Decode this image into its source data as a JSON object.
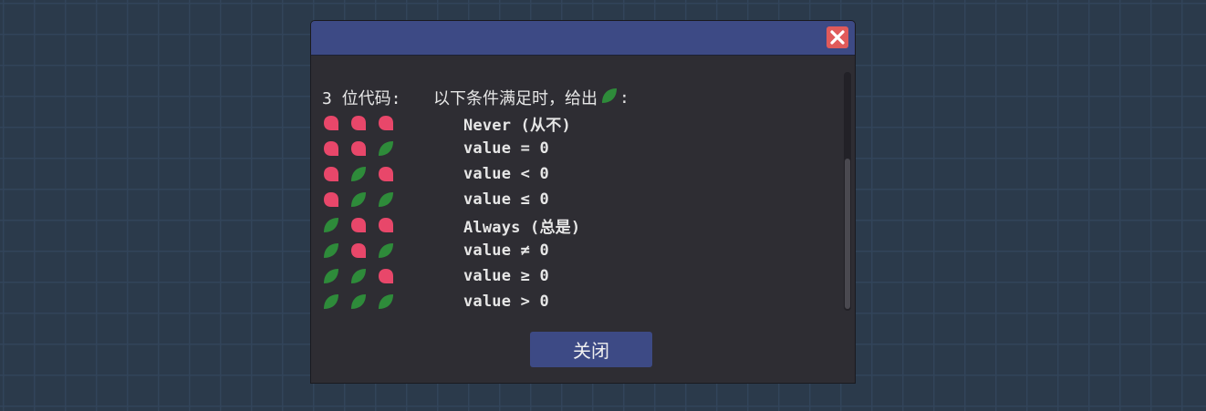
{
  "dialog": {
    "close_button_label": "关闭",
    "header": {
      "code_label": "3 位代码:",
      "condition_label": "以下条件满足时，给出",
      "condition_suffix": ":"
    },
    "rows": [
      {
        "bits": [
          "red",
          "red",
          "red"
        ],
        "condition": "Never (从不)"
      },
      {
        "bits": [
          "red",
          "red",
          "green"
        ],
        "condition": "value = 0"
      },
      {
        "bits": [
          "red",
          "green",
          "red"
        ],
        "condition": "value < 0"
      },
      {
        "bits": [
          "red",
          "green",
          "green"
        ],
        "condition": "value ≤ 0"
      },
      {
        "bits": [
          "green",
          "red",
          "red"
        ],
        "condition": "Always (总是)"
      },
      {
        "bits": [
          "green",
          "red",
          "green"
        ],
        "condition": "value ≠ 0"
      },
      {
        "bits": [
          "green",
          "green",
          "red"
        ],
        "condition": "value ≥ 0"
      },
      {
        "bits": [
          "green",
          "green",
          "green"
        ],
        "condition": "value > 0"
      }
    ]
  },
  "colors": {
    "red_marker": "#e8476a",
    "green_leaf": "#2e8b3a",
    "accent": "#3d4a85",
    "close_icon_bg": "#e05a5a"
  },
  "icons": {
    "close": "close-icon",
    "red": "red-drop-icon",
    "green": "green-leaf-icon"
  }
}
